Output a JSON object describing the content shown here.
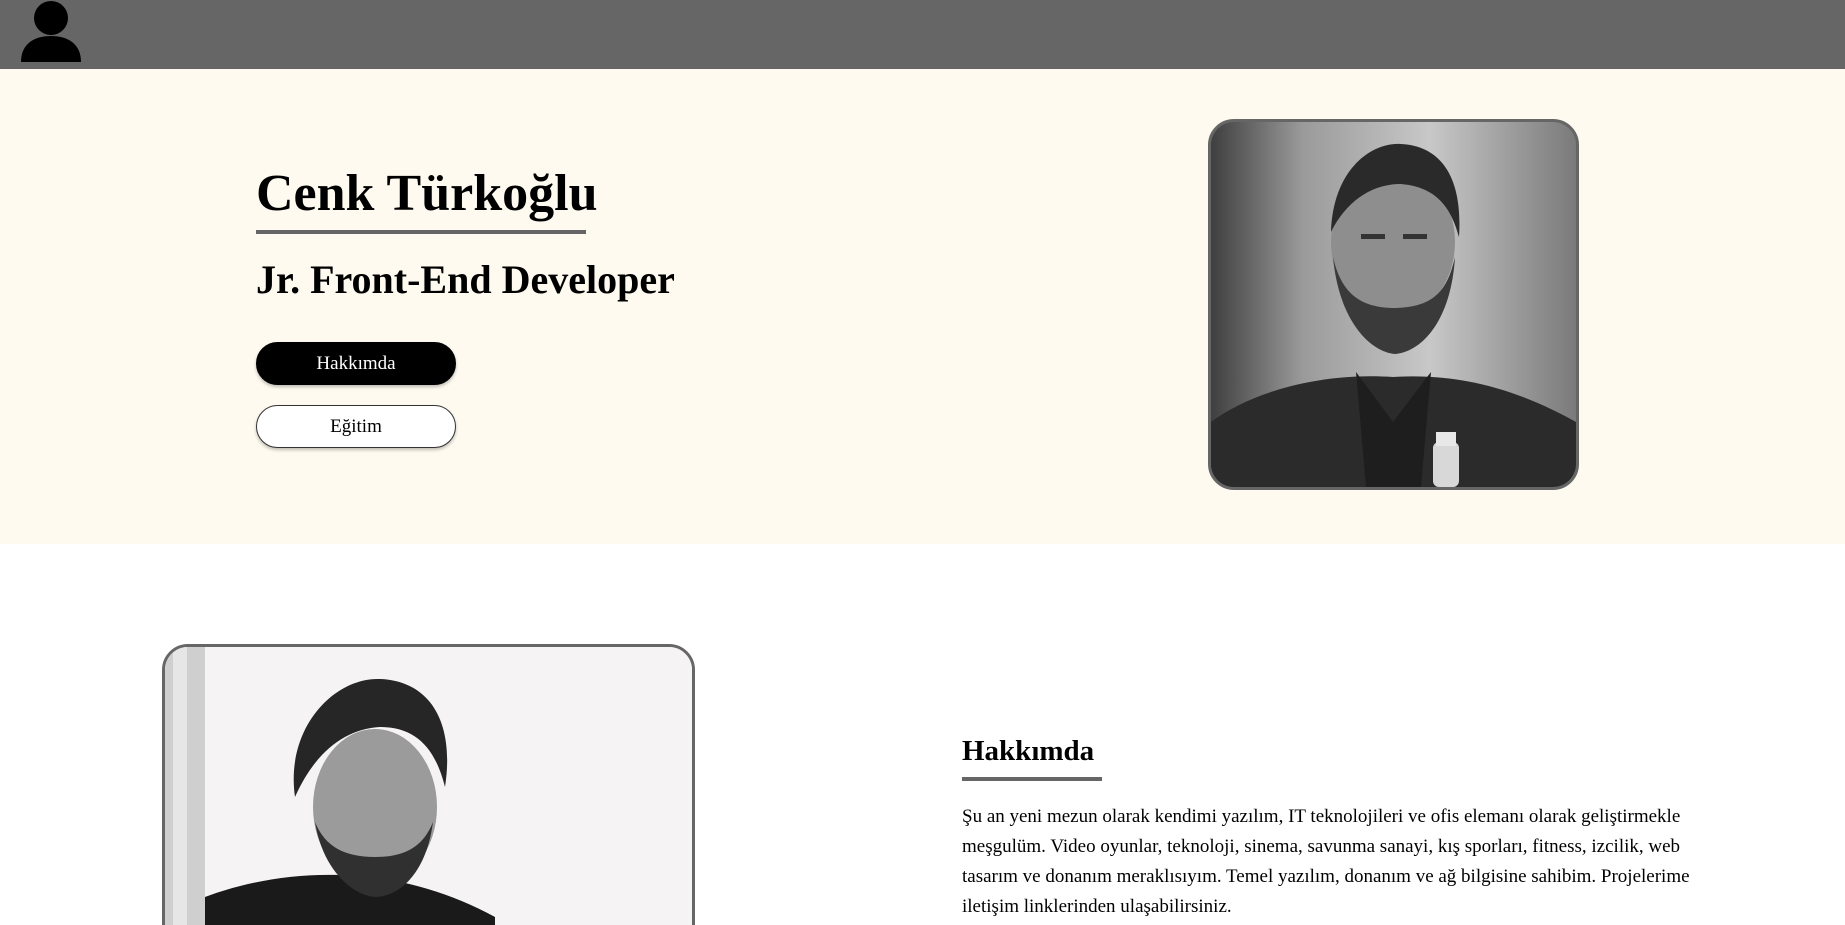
{
  "header": {
    "profile_icon": "user-icon"
  },
  "hero": {
    "name": "Cenk Türkoğlu",
    "role": "Jr. Front-End Developer",
    "buttons": {
      "about": "Hakkımda",
      "education": "Eğitim"
    }
  },
  "about": {
    "title": "Hakkımda",
    "text": "Şu an yeni mezun olarak kendimi yazılım, IT teknolojileri ve ofis elemanı olarak geliştirmekle meşgulüm. Video oyunlar, teknoloji, sinema, savunma sanayi, kış sporları, fitness, izcilik, web tasarım ve donanım meraklısıyım. Temel yazılım, donanım ve ağ bilgisine sahibim. Projelerime iletişim linklerinden ulaşabilirsiniz."
  },
  "colors": {
    "topbar": "#666666",
    "hero_bg": "#fefaf0",
    "button_primary": "#000000"
  }
}
